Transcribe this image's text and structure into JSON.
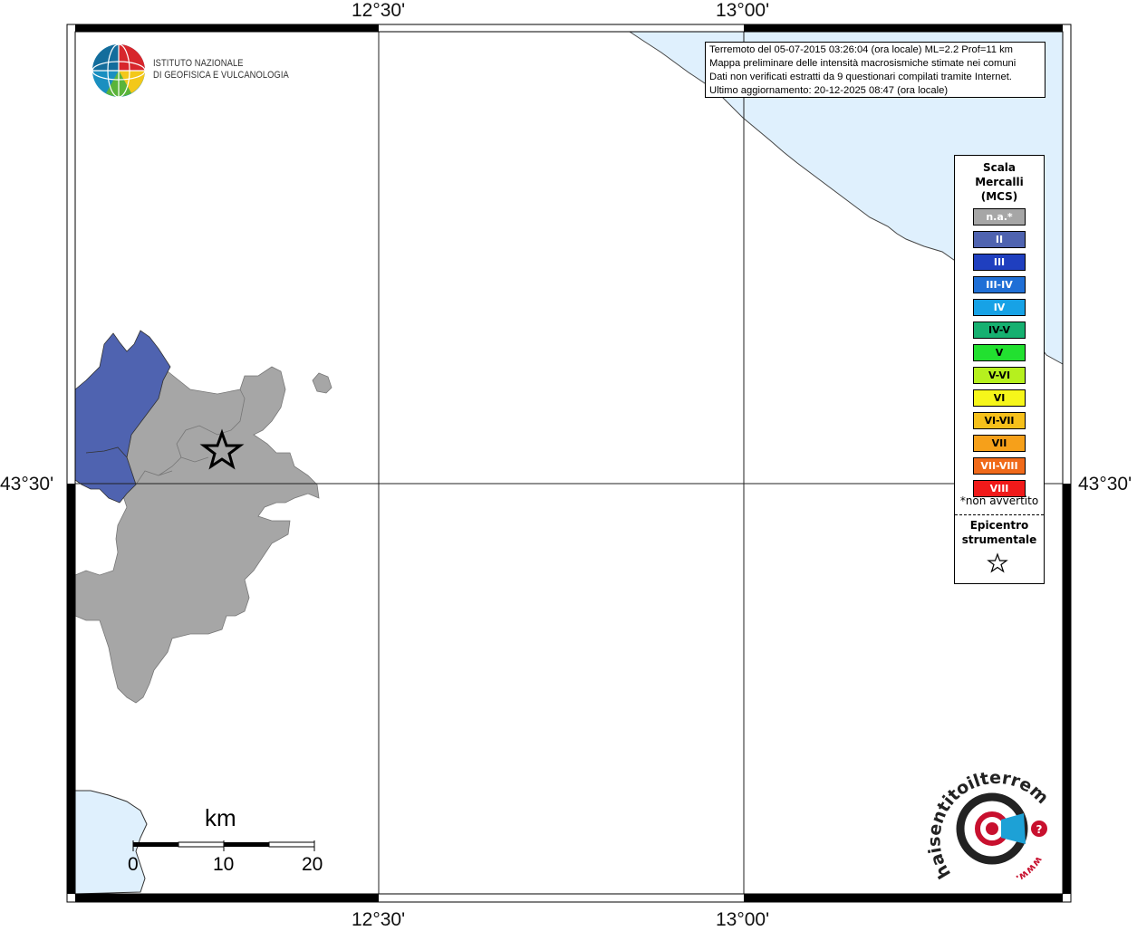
{
  "map": {
    "top_labels": [
      "12°30'",
      "13°00'"
    ],
    "bottom_labels": [
      "12°30'",
      "13°00'"
    ],
    "left_label": "43°30'",
    "right_label": "43°30'"
  },
  "logo": {
    "line1": "ISTITUTO NAZIONALE",
    "line2": "DI GEOFISICA E VULCANOLOGIA"
  },
  "info": {
    "line1": "Terremoto del 05-07-2015 03:26:04 (ora locale) ML=2.2 Prof=11 km",
    "line2": "Mappa preliminare delle intensità macrosismiche stimate nei comuni",
    "line3": "Dati non verificati estratti da 9 questionari compilati tramite Internet.",
    "line4": "Ultimo aggiornamento: 20-12-2025 08:47 (ora locale)"
  },
  "legend": {
    "title1": "Scala",
    "title2": "Mercalli",
    "title3": "(MCS)",
    "items": [
      {
        "label": "n.a.*",
        "color": "#a6a6a6"
      },
      {
        "label": "II",
        "color": "#4f63b0"
      },
      {
        "label": "III",
        "color": "#1f3fbf"
      },
      {
        "label": "III-IV",
        "color": "#1f6fd6"
      },
      {
        "label": "IV",
        "color": "#17a2e6"
      },
      {
        "label": "IV-V",
        "color": "#16b070"
      },
      {
        "label": "V",
        "color": "#22e030"
      },
      {
        "label": "V-VI",
        "color": "#b6f01e"
      },
      {
        "label": "VI",
        "color": "#f6f61a"
      },
      {
        "label": "VI-VII",
        "color": "#f6c01a"
      },
      {
        "label": "VII",
        "color": "#f6a01a"
      },
      {
        "label": "VII-VIII",
        "color": "#f06a1a"
      },
      {
        "label": "VIII",
        "color": "#f01a1a"
      }
    ],
    "note": "*non avvertito",
    "epi1": "Epicentro",
    "epi2": "strumentale"
  },
  "scale": {
    "unit": "km",
    "ticks": [
      "0",
      "10",
      "20"
    ]
  },
  "watermark": {
    "text": "haisentitoilterremoto.it",
    "prefix": "www."
  },
  "colors": {
    "sea": "#dff0fd",
    "intensity_II": "#4f63b0",
    "not_felt": "#a6a6a6"
  }
}
